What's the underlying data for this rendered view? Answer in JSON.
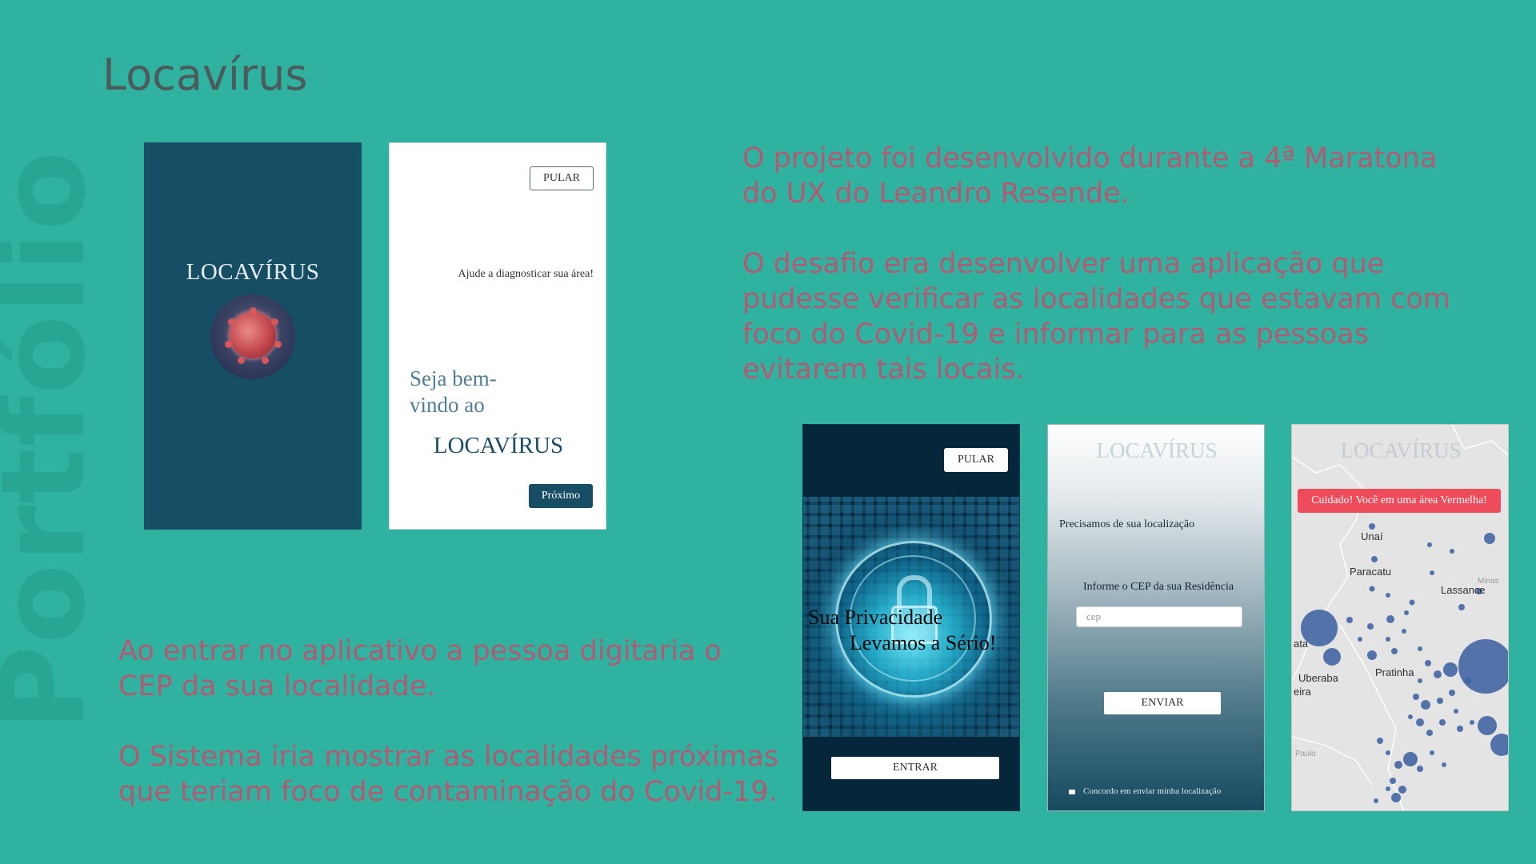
{
  "watermark": "Portfólio",
  "title": "Locavírus",
  "intro": {
    "para1_line1": "O projeto foi desenvolvido durante a 4ª Maratona",
    "para1_line2": "do UX do Leandro Resende.",
    "para2_line1": "O desafio era desenvolver uma aplicação que",
    "para2_line2": "pudesse verificar as localidades que estavam com",
    "para2_line3": "foco do Covid-19 e informar para as pessoas",
    "para2_line4": "evitarem tais locais."
  },
  "description": {
    "para1_line1": "Ao entrar no aplicativo a pessoa digitaria o",
    "para1_line2": "CEP da sua localidade.",
    "para2_line1": "O Sistema iria mostrar as localidades próximas",
    "para2_line2": "que teriam foco de contaminação do Covid-19."
  },
  "screens": {
    "splash": {
      "brand": "LOCAVÍRUS"
    },
    "welcome": {
      "skip_label": "PULAR",
      "helper_text": "Ajude a diagnosticar sua área!",
      "greeting": "Seja bem-vindo ao",
      "brand": "LOCAVÍRUS",
      "next_label": "Próximo"
    },
    "privacy": {
      "skip_label": "PULAR",
      "line1": "Sua Privacidade",
      "line2": "Levamos a Sério!",
      "enter_label": "ENTRAR"
    },
    "location": {
      "brand": "LOCAVÍRUS",
      "need_text": "Precisamos de sua localização",
      "cep_label": "Informe o CEP da sua Residência",
      "cep_placeholder": "cep",
      "send_label": "ENVIAR",
      "consent_text": "Concordo em enviar minha localização"
    },
    "map": {
      "brand": "LOCAVÍRUS",
      "alert_text": "Cuidado! Você em uma área Vermelha!",
      "places": [
        "Unaí",
        "Paracatu",
        "Lassance",
        "Minas",
        "ata",
        "Uberaba",
        "Pratinha",
        "eira",
        "Paulo"
      ]
    }
  },
  "colors": {
    "background": "#2fb3a0",
    "text_accent": "#b35a73",
    "title": "#4d5a5c",
    "brand_dark": "#164e66",
    "alert_red": "#ee4c5a"
  }
}
